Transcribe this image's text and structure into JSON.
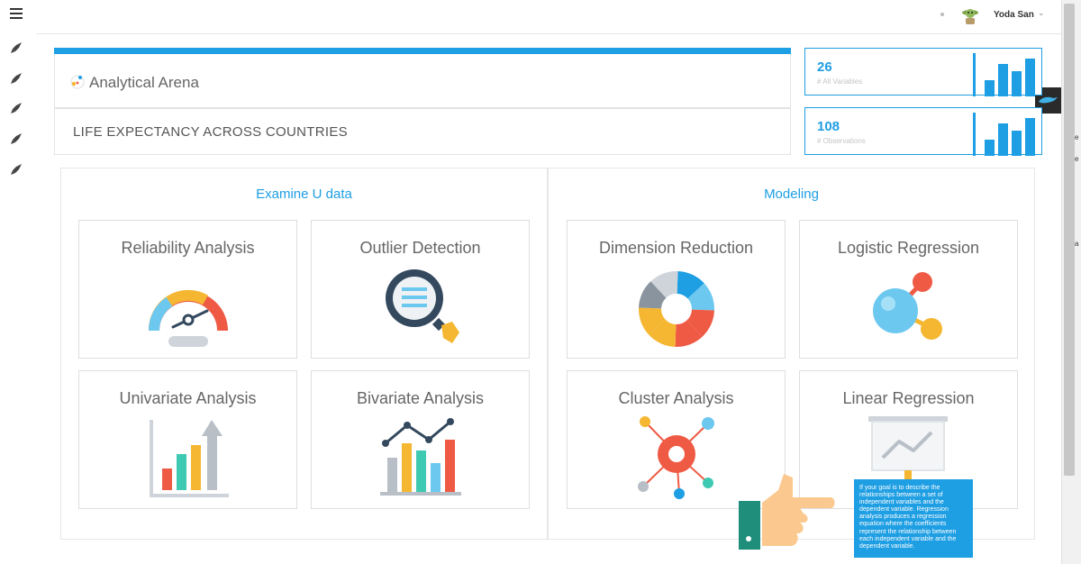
{
  "user": {
    "name": "Yoda San",
    "caret": "⌄"
  },
  "project": {
    "app_name": "Analytical Arena",
    "dataset_title": "LIFE EXPECTANCY ACROSS COUNTRIES"
  },
  "stats": [
    {
      "value": "26",
      "label": "# All Variables"
    },
    {
      "value": "108",
      "label": "# Observations"
    }
  ],
  "panels": {
    "examine": {
      "title": "Examine U data",
      "tiles": [
        {
          "label": "Reliability Analysis",
          "icon": "speedometer-icon"
        },
        {
          "label": "Outlier Detection",
          "icon": "magnifier-icon"
        },
        {
          "label": "Univariate Analysis",
          "icon": "bar-chart-arrow-icon"
        },
        {
          "label": "Bivariate Analysis",
          "icon": "bar-line-chart-icon"
        }
      ]
    },
    "modeling": {
      "title": "Modeling",
      "tiles": [
        {
          "label": "Dimension Reduction",
          "icon": "pie-wheel-icon"
        },
        {
          "label": "Logistic Regression",
          "icon": "molecule-icon"
        },
        {
          "label": "Cluster Analysis",
          "icon": "cluster-icon"
        },
        {
          "label": "Linear Regression",
          "icon": "presentation-board-icon"
        }
      ]
    }
  },
  "tooltip": {
    "text": "If your goal is to describe the relationships between a set of independent variables and the dependent variable. Regression analysis produces a regression equation where the coefficients represent the relationship between each independent variable and the dependent variable."
  },
  "colors": {
    "accent": "#1e9ee3",
    "orange": "#f5b731",
    "red": "#ef5a45",
    "teal": "#3ec9b2",
    "light_blue": "#6dc8f0",
    "gray": "#b9bfc7"
  }
}
